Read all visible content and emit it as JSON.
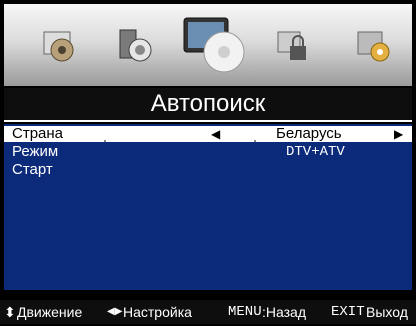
{
  "header": {
    "title": "Автопоиск",
    "icons": [
      "picture-icon",
      "sound-icon",
      "channel-icon",
      "lock-icon",
      "settings-icon"
    ],
    "selected_icon": "channel-icon"
  },
  "menu": {
    "items": [
      {
        "label": "Страна",
        "value": "Беларусь",
        "selected": true
      },
      {
        "label": "Режим",
        "value": "DTV+ATV",
        "selected": false
      },
      {
        "label": "Старт",
        "value": "",
        "selected": false
      }
    ],
    "arrows": {
      "left": "◀",
      "right": "▶"
    }
  },
  "hints": {
    "move_symbol": "⬍",
    "move_label": "Движение",
    "adjust_symbol": "◀▶",
    "adjust_label": "Настройка",
    "back_key": "MENU",
    "back_label": ":Назад",
    "exit_key": "EXIT",
    "exit_label": "Выход"
  },
  "colors": {
    "menu_bg": "#0b2a7a",
    "selected_bg": "#ffffff",
    "bar_bg": "#0e0e0e"
  }
}
